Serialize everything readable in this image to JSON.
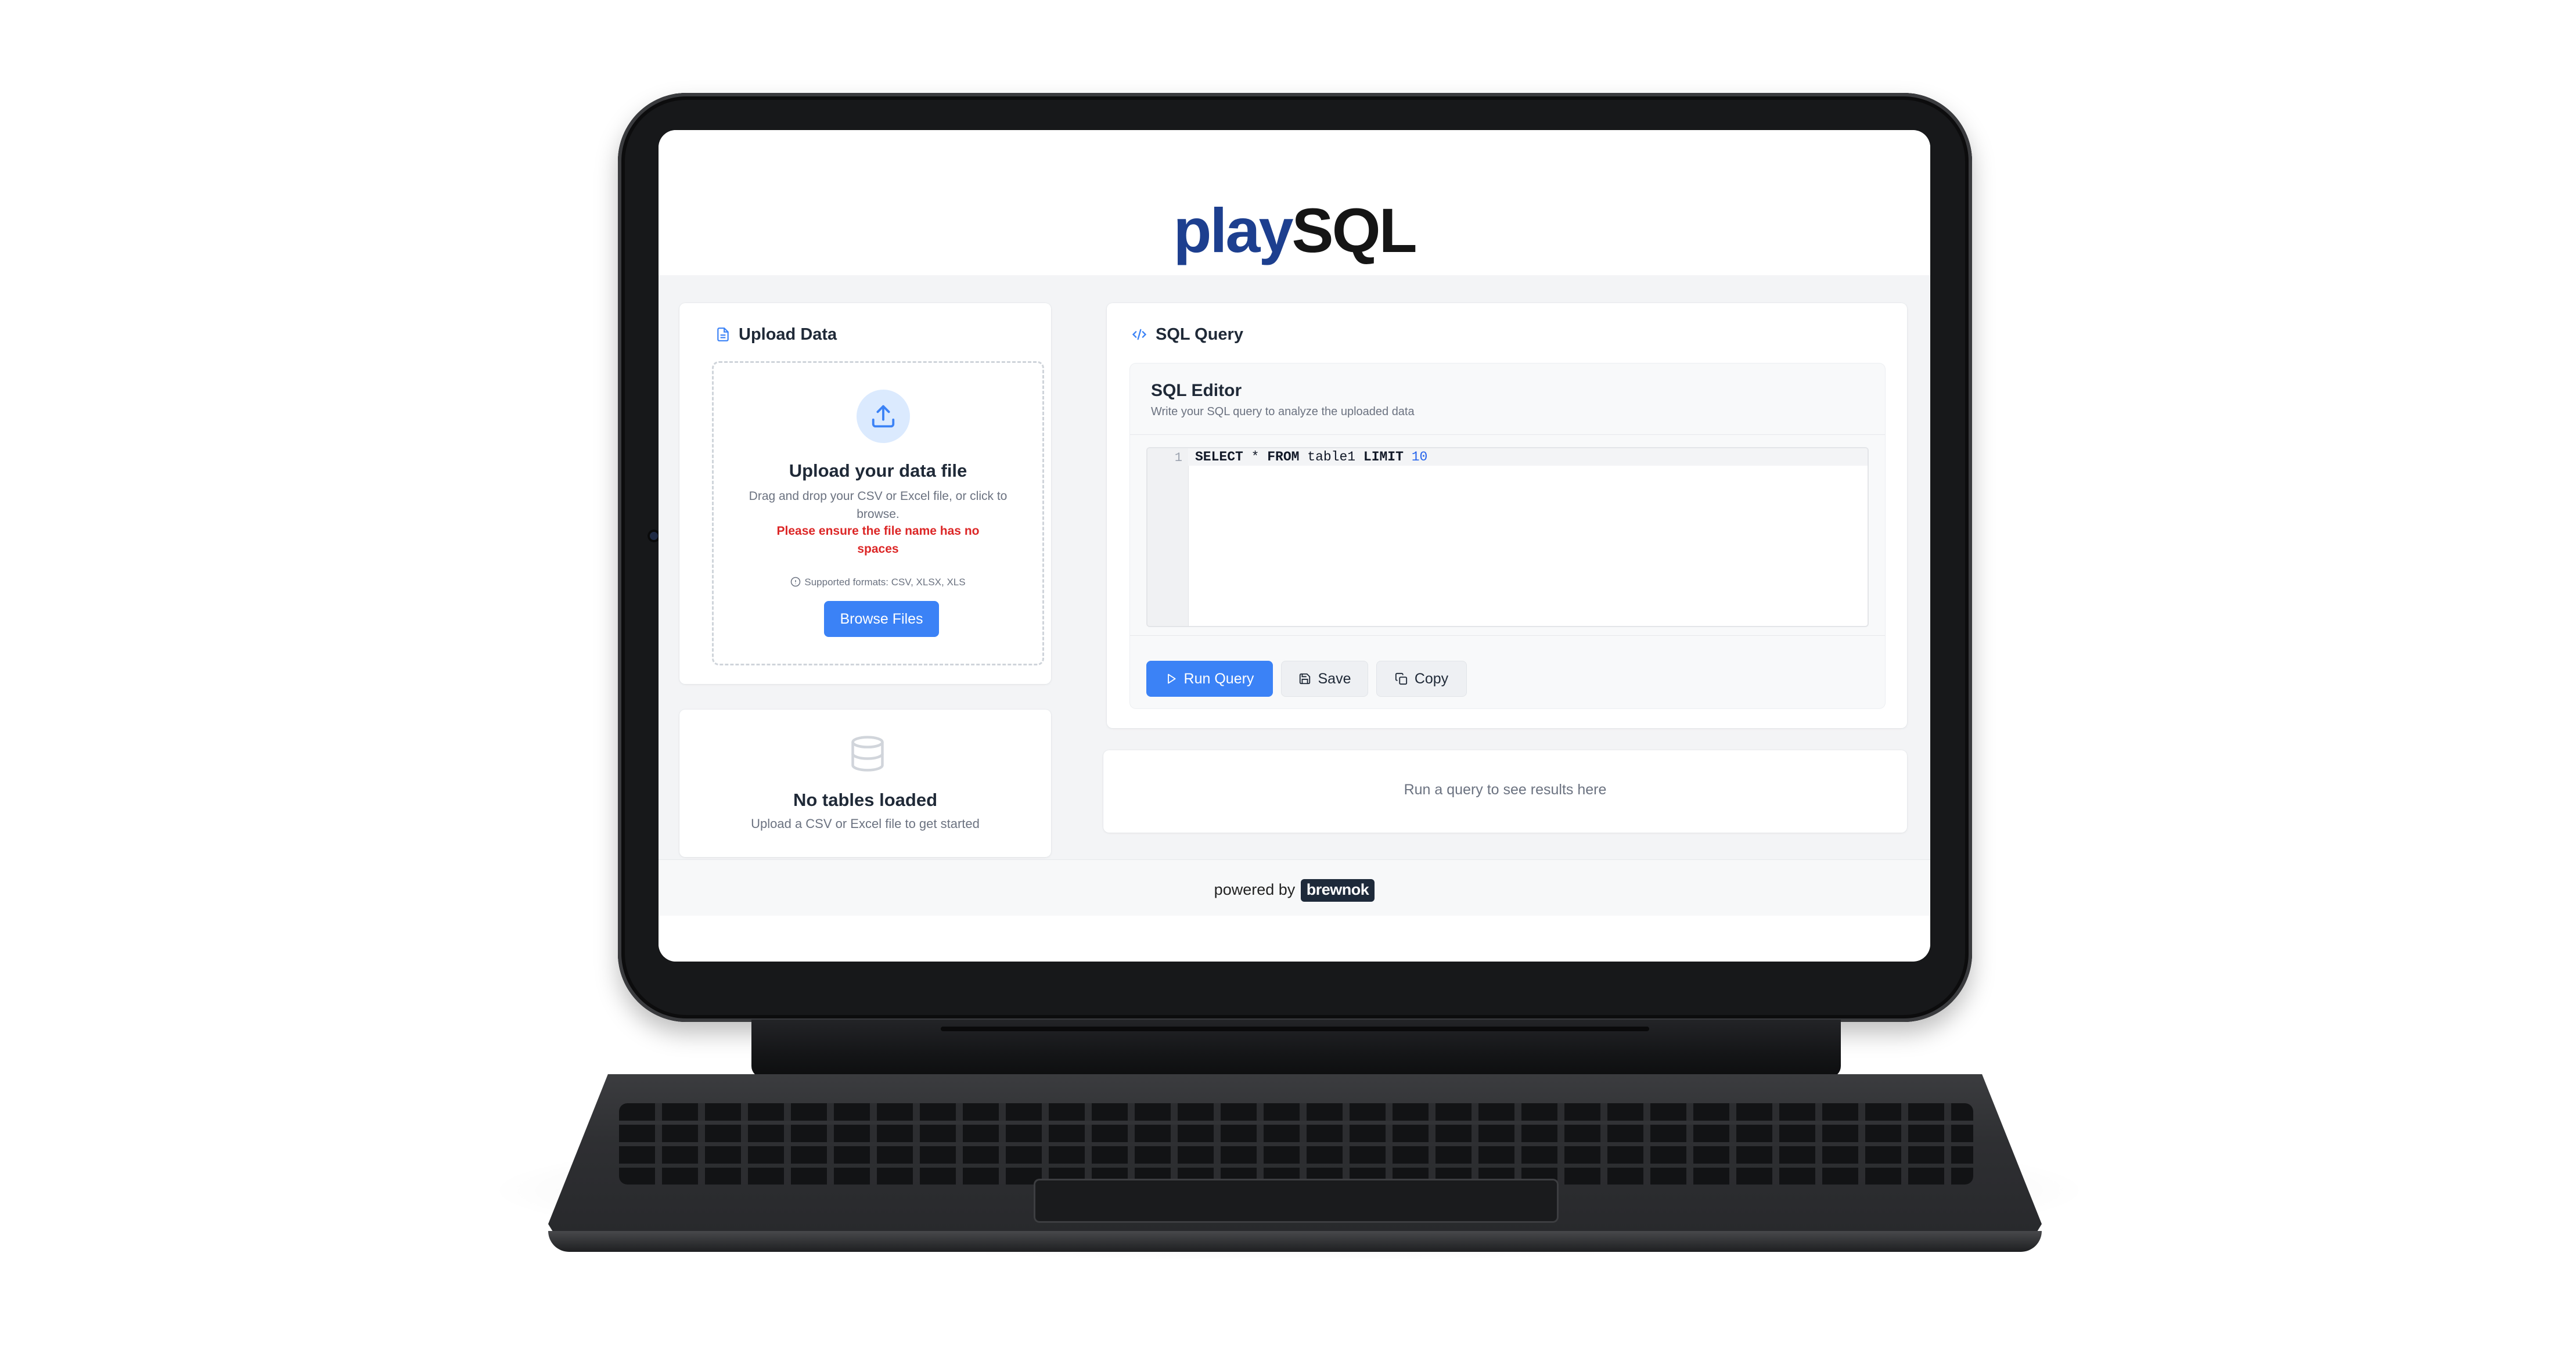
{
  "app": {
    "logo_play": "play",
    "logo_sql": "SQL"
  },
  "upload": {
    "title": "Upload Data",
    "dropzone_title": "Upload your data file",
    "dropzone_desc": "Drag and drop your CSV or Excel file, or click to browse.",
    "warning": "Please ensure the file name has no spaces",
    "formats": "Supported formats: CSV, XLSX, XLS",
    "browse_label": "Browse Files",
    "icon": "file-icon",
    "upload_icon": "upload-icon"
  },
  "tables": {
    "empty_title": "No tables loaded",
    "empty_sub": "Upload a CSV or Excel file to get started",
    "icon": "database-icon"
  },
  "query": {
    "title": "SQL Query",
    "icon": "code-icon",
    "editor_title": "SQL Editor",
    "editor_sub": "Write your SQL query to analyze the uploaded data",
    "line_number": "1",
    "code": {
      "select": "SELECT",
      "star": " * ",
      "from": "FROM",
      "table": " table1 ",
      "limit": "LIMIT",
      "space": " ",
      "num": "10"
    },
    "run_label": "Run Query",
    "save_label": "Save",
    "copy_label": "Copy"
  },
  "results": {
    "placeholder": "Run a query to see results here"
  },
  "footer": {
    "powered_by": "powered by",
    "brand": "brewnok"
  },
  "colors": {
    "primary": "#3b82f6",
    "logo_blue": "#1d3f8f",
    "warning": "#dc2626",
    "page_bg": "#f3f4f6"
  }
}
